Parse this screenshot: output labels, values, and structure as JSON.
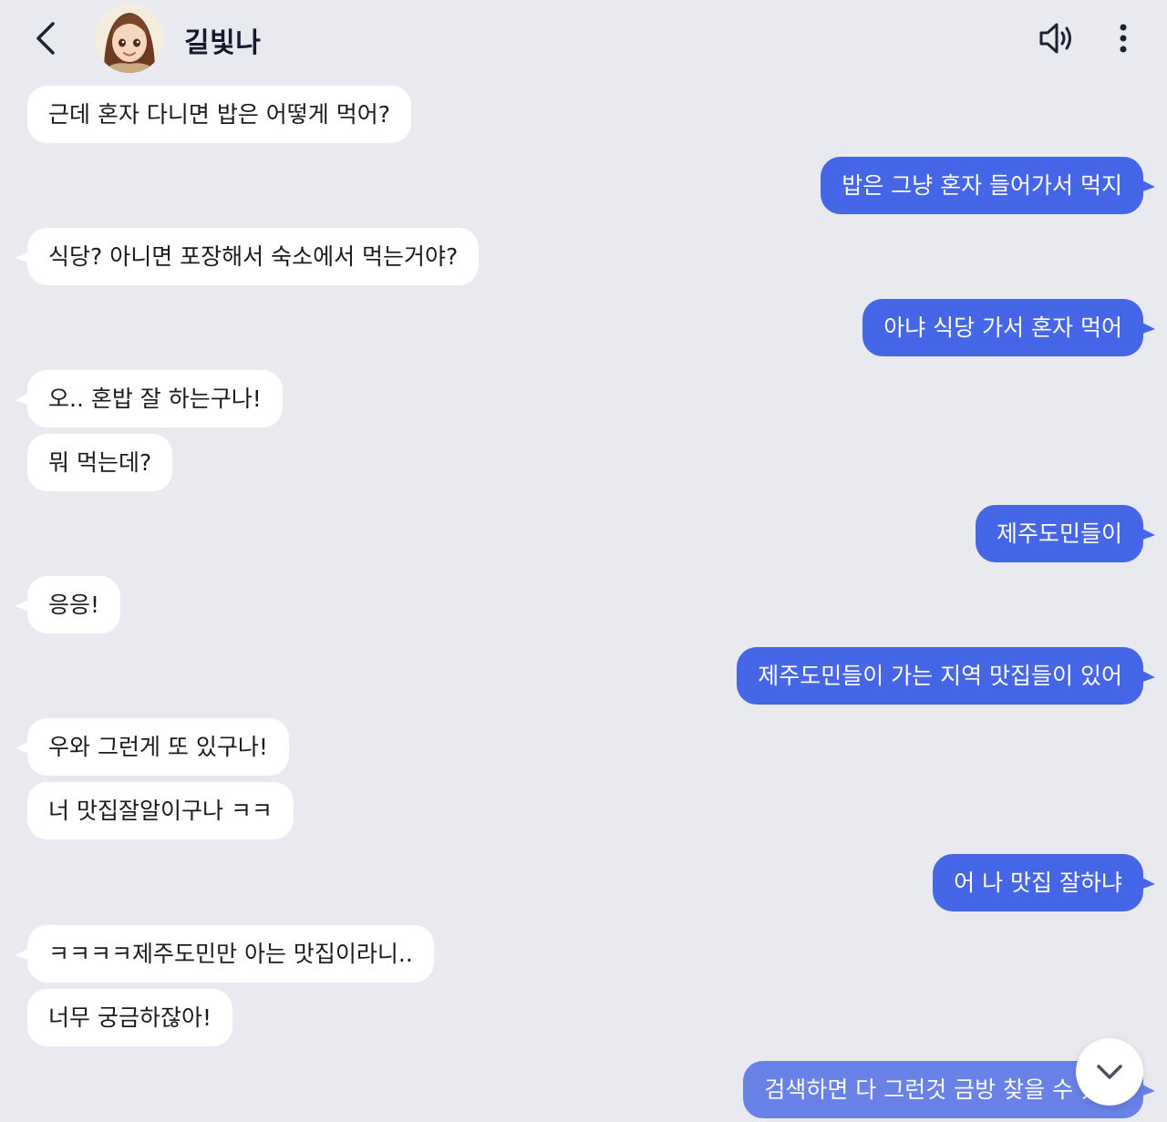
{
  "header": {
    "back_icon": "chevron-left-icon",
    "name": "길빛나",
    "speaker_icon": "speaker-icon",
    "more_icon": "more-vertical-icon"
  },
  "colors": {
    "background": "#e9eaef",
    "incoming_bubble": "#ffffff",
    "outgoing_bubble": "#4566e6"
  },
  "messages": [
    {
      "sender": "bot",
      "text": "근데 혼자 다니면 밥은 어떻게 먹어?"
    },
    {
      "sender": "user",
      "text": "밥은 그냥 혼자 들어가서 먹지"
    },
    {
      "sender": "bot",
      "text": "식당? 아니면 포장해서 숙소에서 먹는거야?"
    },
    {
      "sender": "user",
      "text": "아냐 식당 가서 혼자 먹어"
    },
    {
      "sender": "bot",
      "text": "오.. 혼밥 잘 하는구나!"
    },
    {
      "sender": "bot",
      "text": "뭐 먹는데?"
    },
    {
      "sender": "user",
      "text": "제주도민들이"
    },
    {
      "sender": "bot",
      "text": "응응!"
    },
    {
      "sender": "user",
      "text": "제주도민들이 가는 지역 맛집들이 있어"
    },
    {
      "sender": "bot",
      "text": "우와 그런게 또 있구나!"
    },
    {
      "sender": "bot",
      "text": "너 맛집잘알이구나 ㅋㅋ"
    },
    {
      "sender": "user",
      "text": "어 나 맛집 잘하냐"
    },
    {
      "sender": "bot",
      "text": "ㅋㅋㅋㅋ제주도민만 아는 맛집이라니.."
    },
    {
      "sender": "bot",
      "text": "너무 궁금하잖아!"
    },
    {
      "sender": "user",
      "text": "검색하면 다 그런것 금방 찾을 수 있어"
    }
  ],
  "scroll_down_icon": "chevron-down-icon"
}
